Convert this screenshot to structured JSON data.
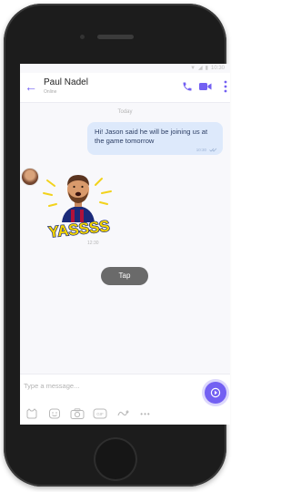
{
  "status_bar": {
    "time": "10:30"
  },
  "header": {
    "contact_name": "Paul Nadel",
    "contact_status": "Online"
  },
  "conversation": {
    "date_label": "Today",
    "outgoing_message": {
      "text": "Hi! Jason said he will be joining us at the game tomorrow",
      "time": "10:30"
    },
    "sticker": {
      "text": "YASSSS",
      "time": "12:30"
    },
    "tap_label": "Tap"
  },
  "input": {
    "placeholder": "Type a message..."
  },
  "colors": {
    "accent": "#7360f2",
    "outgoing_bubble": "#dde9fb",
    "tap_pill": "#6a6a6a"
  },
  "icons": {
    "header": [
      "back-arrow-icon",
      "phone-icon",
      "video-camera-icon",
      "more-vertical-icon"
    ],
    "toolbar": [
      "sticker-icon",
      "emoji-icon",
      "camera-icon",
      "gif-icon",
      "doodle-icon",
      "more-icon"
    ]
  }
}
